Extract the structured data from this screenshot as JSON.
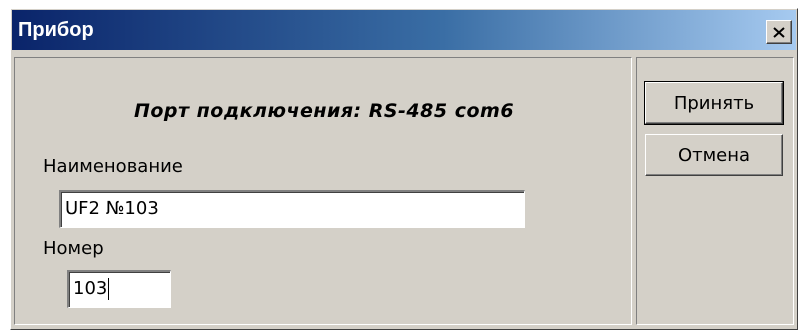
{
  "window": {
    "title": "Прибор",
    "close_icon": "close-icon"
  },
  "form": {
    "port_label": "Порт подключения: RS-485 com6",
    "name_label": "Наименование",
    "name_value": "UF2 №103",
    "number_label": "Номер",
    "number_value": "103"
  },
  "buttons": {
    "accept_label": "Принять",
    "cancel_label": "Отмена"
  },
  "colors": {
    "face": "#d4d0c8",
    "title_start": "#0a246a",
    "title_end": "#a6caf0"
  }
}
